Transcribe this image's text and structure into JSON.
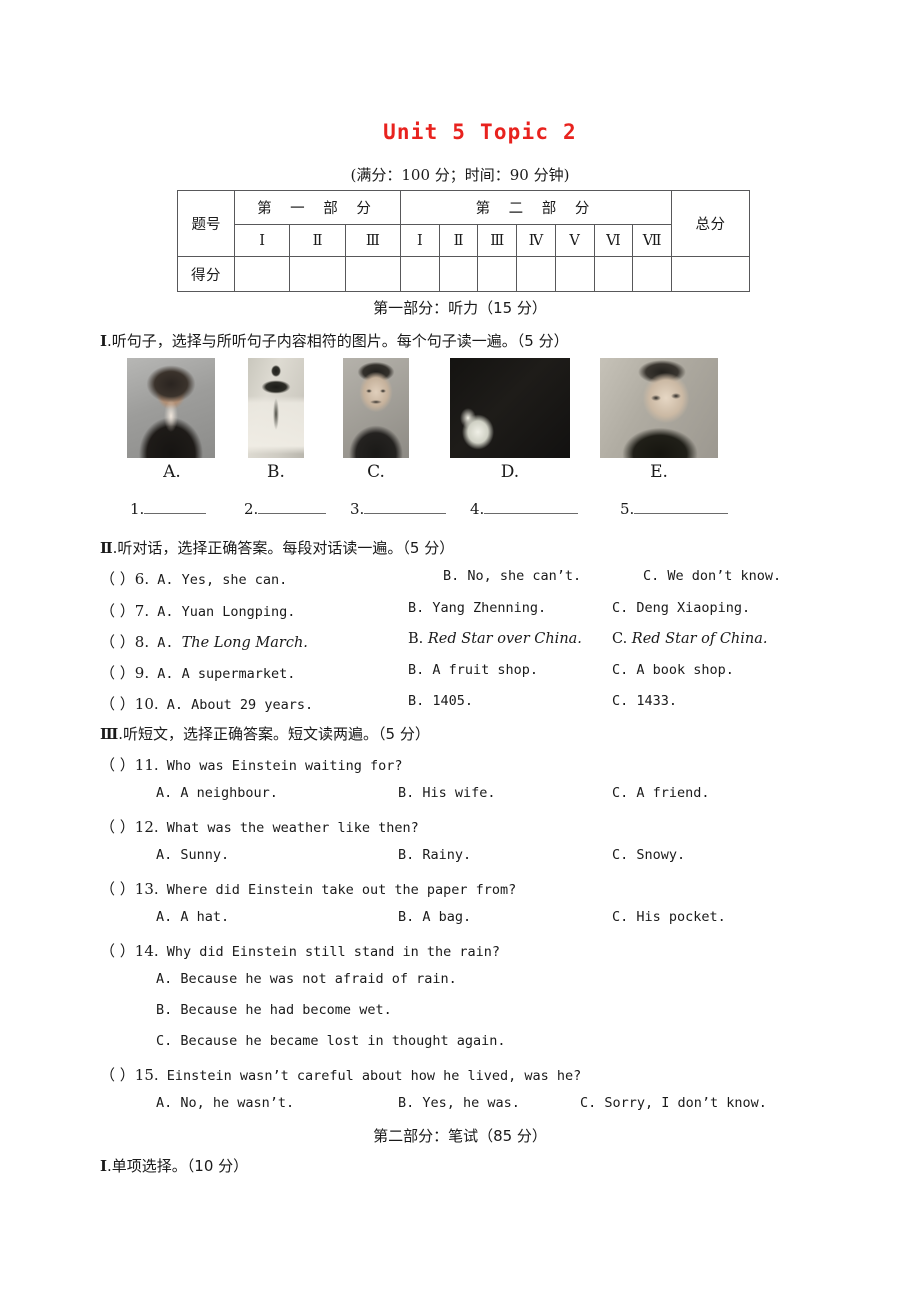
{
  "title": "Unit 5  Topic 2",
  "subtitle": "(满分：100 分；时间：90 分钟)",
  "score_table": {
    "row_label_question": "题号",
    "row_label_score": "得分",
    "part1_header": "第 一 部 分",
    "part2_header": "第 二 部 分",
    "total_header": "总分",
    "part1_items": [
      "Ⅰ",
      "Ⅱ",
      "Ⅲ"
    ],
    "part2_items": [
      "Ⅰ",
      "Ⅱ",
      "Ⅲ",
      "Ⅳ",
      "Ⅴ",
      "Ⅵ",
      "Ⅶ"
    ]
  },
  "part1_heading": "第一部分：听力（15 分）",
  "part2_heading": "第二部分：笔试（85 分）",
  "section_1": {
    "marker": "Ⅰ",
    "instruction": ".听句子，选择与所听句子内容相符的图片。每个句子读一遍。（5 分）",
    "pictures": [
      {
        "label": "A.",
        "alt": "portrait-photo-a"
      },
      {
        "label": "B.",
        "alt": "portrait-photo-b"
      },
      {
        "label": "C.",
        "alt": "portrait-photo-c"
      },
      {
        "label": "D.",
        "alt": "portrait-photo-d"
      },
      {
        "label": "E.",
        "alt": "portrait-photo-e"
      }
    ],
    "blanks": [
      "1.",
      "2.",
      "3.",
      "4.",
      "5."
    ]
  },
  "section_2": {
    "marker": "Ⅱ",
    "instruction": ".听对话，选择正确答案。每段对话读一遍。（5 分）",
    "questions": [
      {
        "paren": "（ ）",
        "num": "6.",
        "a": "A. Yes, she can.",
        "b": "B. No, she can’t.",
        "c": "C. We don’t know."
      },
      {
        "paren": "（ ）",
        "num": "7.",
        "a": "A. Yuan Longping.",
        "b": "B. Yang Zhenning.",
        "c": "C. Deng Xiaoping."
      },
      {
        "paren": "（ ）",
        "num": "8.",
        "a_letter": "A. ",
        "a_title": "The Long March.",
        "b_letter": "B. ",
        "b_title": "Red Star over China.",
        "c_letter": "C. ",
        "c_title": "Red Star of China.",
        "italic": true
      },
      {
        "paren": "（ ）",
        "num": "9.",
        "a": "A. A supermarket.",
        "b": "B. A fruit shop.",
        "c": "C. A book shop."
      },
      {
        "paren": "（ ）",
        "num": "10.",
        "a": "A. About 29 years.",
        "b": "B. 1405.",
        "c": "C. 1433."
      }
    ]
  },
  "section_3": {
    "marker": "Ⅲ",
    "instruction": ".听短文，选择正确答案。短文读两遍。（5 分）",
    "questions": [
      {
        "paren": "（ ）",
        "num": "11.",
        "stem": "Who was Einstein waiting for?",
        "a": "A. A neighbour.",
        "b": "B. His wife.",
        "c": "C. A friend.",
        "layout": "row"
      },
      {
        "paren": "（ ）",
        "num": "12.",
        "stem": "What was the weather like then?",
        "a": "A. Sunny.",
        "b": "B. Rainy.",
        "c": "C. Snowy.",
        "layout": "row"
      },
      {
        "paren": "（ ）",
        "num": "13.",
        "stem": "Where did Einstein take out the paper from?",
        "a": "A. A hat.",
        "b": "B. A bag.",
        "c": "C. His pocket.",
        "layout": "row"
      },
      {
        "paren": "（ ）",
        "num": "14.",
        "stem": "Why did Einstein still stand in the rain?",
        "a": "A. Because he was not afraid of rain.",
        "b": "B. Because he had become wet.",
        "c": "C. Because he became lost in thought again.",
        "layout": "stacked"
      },
      {
        "paren": "（ ）",
        "num": "15.",
        "stem": "Einstein wasn’t careful about how he lived, was he?",
        "a": "A. No, he wasn’t.",
        "b": "B. Yes, he was.",
        "c": "C. Sorry, I don’t know.",
        "layout": "row"
      }
    ]
  },
  "section_4": {
    "marker": "Ⅰ",
    "instruction": ".单项选择。（10 分）"
  },
  "colors": {
    "title_red": "#e8221e",
    "table_border": "#58585a",
    "text": "#1a1a1a"
  }
}
